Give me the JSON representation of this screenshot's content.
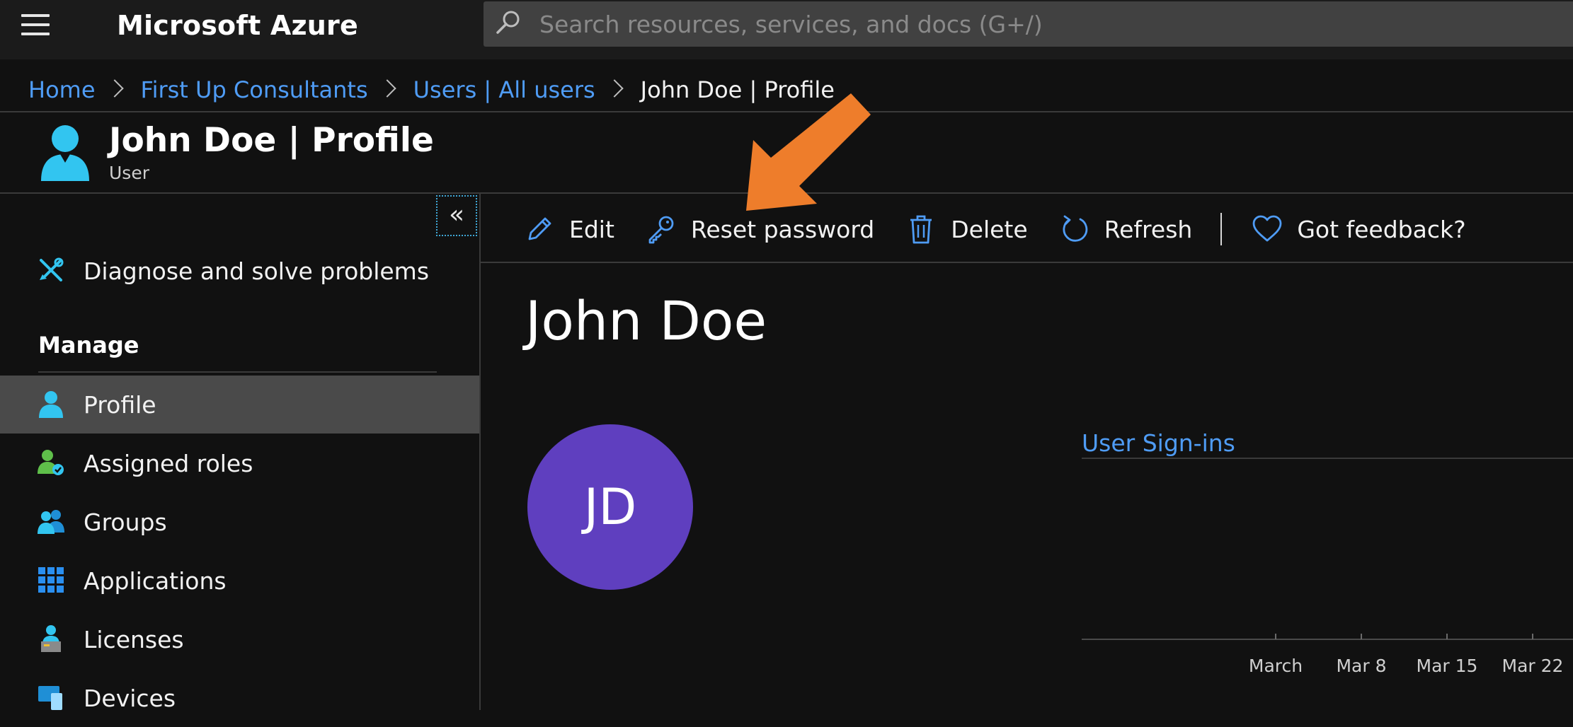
{
  "app": {
    "title": "Microsoft Azure"
  },
  "search": {
    "placeholder": "Search resources, services, and docs (G+/)"
  },
  "breadcrumb": [
    {
      "label": "Home"
    },
    {
      "label": "First Up Consultants"
    },
    {
      "label": "Users | All users"
    },
    {
      "label": "John Doe | Profile"
    }
  ],
  "header": {
    "title": "John Doe | Profile",
    "subtitle": "User"
  },
  "sidebar": {
    "collapse_label": "«",
    "diagnose_label": "Diagnose and solve problems",
    "section_manage": "Manage",
    "items": [
      {
        "label": "Profile",
        "icon": "user-icon",
        "selected": true
      },
      {
        "label": "Assigned roles",
        "icon": "user-role-icon"
      },
      {
        "label": "Groups",
        "icon": "group-icon"
      },
      {
        "label": "Applications",
        "icon": "apps-grid-icon"
      },
      {
        "label": "Licenses",
        "icon": "license-icon"
      },
      {
        "label": "Devices",
        "icon": "devices-icon"
      }
    ]
  },
  "toolbar": {
    "edit_label": "Edit",
    "reset_password_label": "Reset password",
    "delete_label": "Delete",
    "refresh_label": "Refresh",
    "feedback_label": "Got feedback?"
  },
  "profile": {
    "name": "John Doe",
    "initials": "JD"
  },
  "signins": {
    "title": "User Sign-ins"
  },
  "chart_data": {
    "type": "line",
    "title": "User Sign-ins",
    "x_ticks": [
      "March",
      "Mar 8",
      "Mar 15",
      "Mar 22"
    ],
    "series": []
  },
  "colors": {
    "accent_blue": "#4f9cf5",
    "avatar_purple": "#5f3fbf",
    "callout_orange": "#ee7d2b",
    "selected_bg": "#4a4a4a"
  }
}
